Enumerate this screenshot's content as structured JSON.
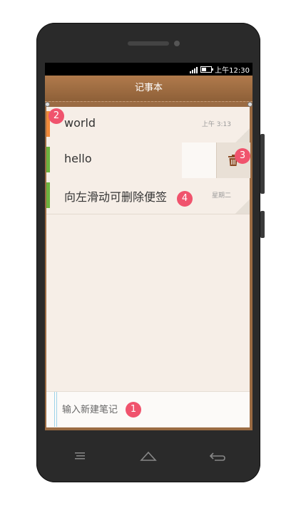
{
  "status_bar": {
    "time": "上午12:30"
  },
  "header": {
    "title": "记事本"
  },
  "notes": [
    {
      "title": "world",
      "date": "上午 3:13",
      "tag_color": "#f08a3a"
    },
    {
      "title": "hello",
      "date": "",
      "tag_color": "#6db33f"
    },
    {
      "title": "向左滑动可删除便签",
      "date": "星期二",
      "tag_color": "#6db33f"
    }
  ],
  "input": {
    "placeholder": "输入新建笔记"
  },
  "badges": {
    "b1": "1",
    "b2": "2",
    "b3": "3",
    "b4": "4"
  },
  "colors": {
    "header": "#9a6b43",
    "paper": "#f6eee7",
    "badge": "#f0536d"
  },
  "icons": {
    "delete": "trash-icon",
    "nav": [
      "menu-icon",
      "home-icon",
      "back-icon"
    ]
  }
}
